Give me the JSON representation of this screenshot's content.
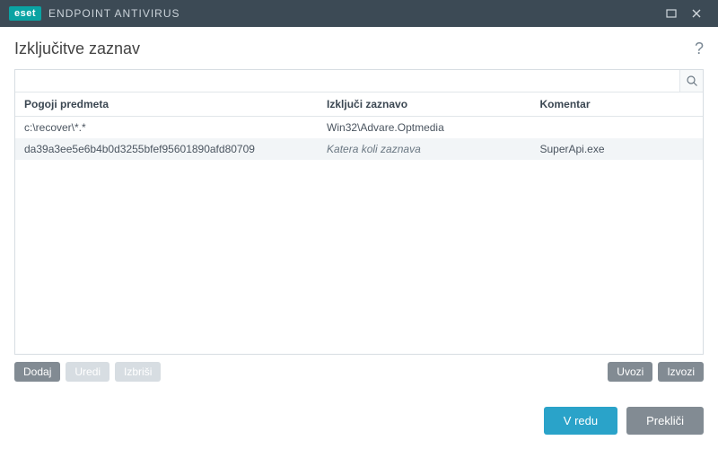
{
  "titlebar": {
    "brand_badge": "eset",
    "product": "ENDPOINT ANTIVIRUS"
  },
  "page": {
    "title": "Izključitve zaznav",
    "help_tooltip": "?"
  },
  "search": {
    "value": "",
    "placeholder": ""
  },
  "table": {
    "columns": {
      "object_conditions": "Pogoji predmeta",
      "exclude_detection": "Izključi zaznavo",
      "comment": "Komentar"
    },
    "rows": [
      {
        "object": "c:\\recover\\*.*",
        "detection": "Win32\\Advare.Optmedia",
        "detection_italic": false,
        "comment": ""
      },
      {
        "object": "da39a3ee5e6b4b0d3255bfef95601890afd80709",
        "detection": "Katera koli zaznava",
        "detection_italic": true,
        "comment": "SuperApi.exe"
      }
    ]
  },
  "toolbar": {
    "add": "Dodaj",
    "edit": "Uredi",
    "delete": "Izbriši",
    "import": "Uvozi",
    "export": "Izvozi"
  },
  "footer": {
    "ok": "V redu",
    "cancel": "Prekliči"
  }
}
